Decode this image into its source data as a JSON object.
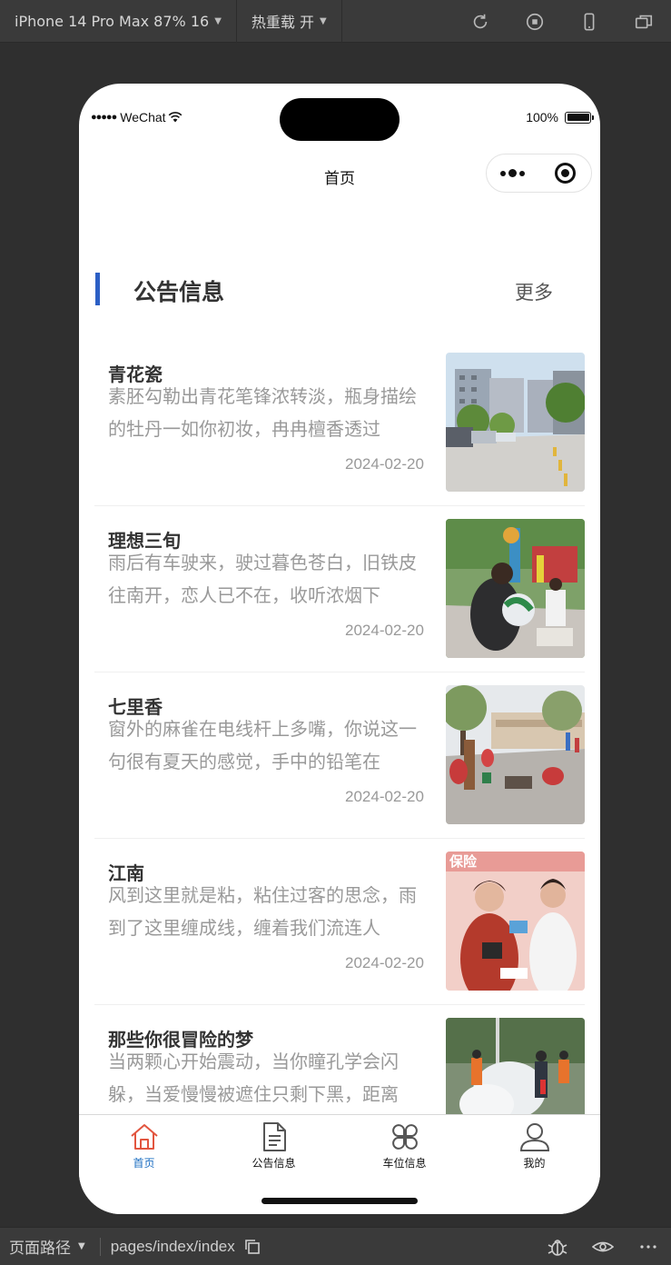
{
  "devtools": {
    "device_select": "iPhone 14 Pro Max 87% 16",
    "hot_reload": "热重载 开",
    "icons": [
      "refresh-icon",
      "stop-icon",
      "phone-icon",
      "window-icon"
    ],
    "path_label": "页面路径",
    "path_value": "pages/index/index",
    "bottom_icons": [
      "copy-icon",
      "bug-icon",
      "eye-icon",
      "more-icon"
    ]
  },
  "status_bar": {
    "carrier": "WeChat",
    "battery": "100%"
  },
  "nav": {
    "title": "首页"
  },
  "section": {
    "title": "公告信息",
    "more": "更多",
    "accent_color": "#2c5fc5"
  },
  "news": [
    {
      "title": "青花瓷",
      "desc": "素胚勾勒出青花笔锋浓转淡，瓶身描绘的牡丹一如你初妆，冉冉檀香透过",
      "date": "2024-02-20"
    },
    {
      "title": "理想三旬",
      "desc": "雨后有车驶来，驶过暮色苍白，旧铁皮往南开，恋人已不在，收听浓烟下",
      "date": "2024-02-20"
    },
    {
      "title": "七里香",
      "desc": "窗外的麻雀在电线杆上多嘴，你说这一句很有夏天的感觉，手中的铅笔在",
      "date": "2024-02-20"
    },
    {
      "title": "江南",
      "desc": "风到这里就是粘，粘住过客的思念，雨到了这里缠成线，缠着我们流连人",
      "date": "2024-02-20"
    },
    {
      "title": "那些你很冒险的梦",
      "desc": "当两颗心开始震动，当你瞳孔学会闪躲，当爱慢慢被遮住只剩下黑，距离",
      "date": ""
    }
  ],
  "image_text": {
    "banner": "保险"
  },
  "tabbar": {
    "items": [
      {
        "label": "首页",
        "icon": "home-icon",
        "active": true
      },
      {
        "label": "公告信息",
        "icon": "document-icon",
        "active": false
      },
      {
        "label": "车位信息",
        "icon": "grid-icon",
        "active": false
      },
      {
        "label": "我的",
        "icon": "user-icon",
        "active": false
      }
    ],
    "active_color": "#1b6dc1",
    "active_icon_color": "#e2553f"
  }
}
